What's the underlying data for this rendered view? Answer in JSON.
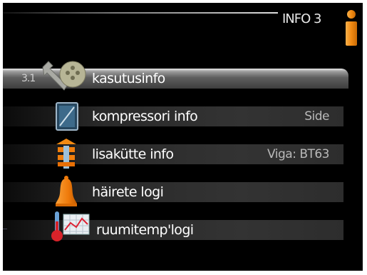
{
  "header": {
    "title": "INFO 3",
    "icon": "info-icon",
    "accent_color": "#f28a12"
  },
  "menu": {
    "number": "3.1",
    "items": [
      {
        "label": "kasutusinfo",
        "value": "",
        "icon": "wrench-icon",
        "selected": true
      },
      {
        "label": "kompressori info",
        "value": "Side",
        "icon": "compressor-icon",
        "selected": false
      },
      {
        "label": "lisakütte info",
        "value": "Viga: BT63",
        "icon": "heater-icon",
        "selected": false
      },
      {
        "label": "häirete logi",
        "value": "",
        "icon": "bell-icon",
        "selected": false
      },
      {
        "label": "ruumitemp'logi",
        "value": "",
        "icon": "temp-graph-icon",
        "selected": false
      }
    ]
  }
}
